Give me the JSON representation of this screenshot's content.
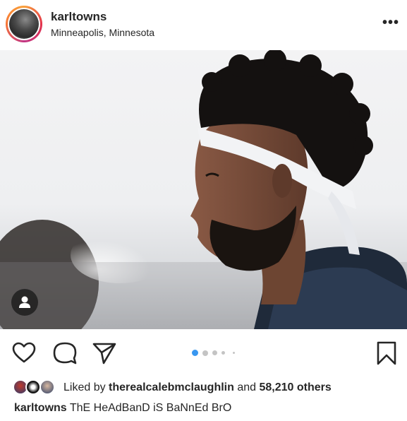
{
  "post": {
    "username": "karltowns",
    "location": "Minneapolis, Minnesota",
    "more_label": "•••",
    "photo_alt": "karltowns post photo",
    "carousel": {
      "total": 4,
      "current": 1
    },
    "likes": {
      "prefix": "Liked by",
      "liker": "therealcalebmclaughlin",
      "and_text": "and",
      "others": "58,210 others"
    },
    "caption": {
      "username": "karltowns",
      "text": "ThE HeAdBanD iS BaNnEd BrO"
    }
  },
  "colors": {
    "carousel_active": "#3897f0",
    "carousel_inactive": "#c4c4c4",
    "text": "#262626",
    "story_ring": [
      "#f9a13a",
      "#e3314b",
      "#c13584"
    ]
  },
  "icons": {
    "like": "heart-icon",
    "comment": "comment-icon",
    "share": "paper-plane-icon",
    "save": "bookmark-icon",
    "tag": "person-tag-icon",
    "more": "more-options-icon"
  }
}
